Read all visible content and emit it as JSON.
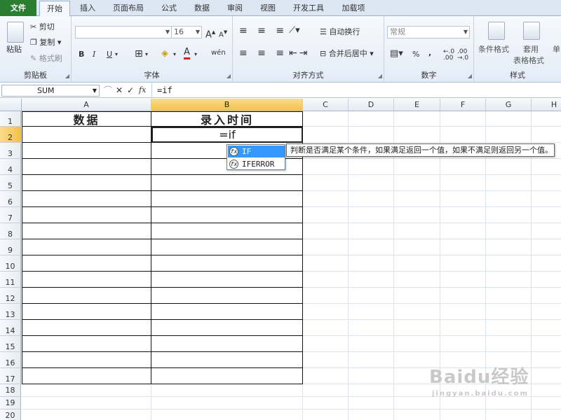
{
  "tabs": [
    {
      "label": "文件",
      "key": "file"
    },
    {
      "label": "开始",
      "key": "home"
    },
    {
      "label": "插入",
      "key": "insert"
    },
    {
      "label": "页面布局",
      "key": "layout"
    },
    {
      "label": "公式",
      "key": "formulas"
    },
    {
      "label": "数据",
      "key": "data"
    },
    {
      "label": "审阅",
      "key": "review"
    },
    {
      "label": "视图",
      "key": "view"
    },
    {
      "label": "开发工具",
      "key": "dev"
    },
    {
      "label": "加载项",
      "key": "addins"
    }
  ],
  "ribbon": {
    "clipboard": {
      "group": "剪贴板",
      "paste": "粘贴",
      "cut": "剪切",
      "copy": "复制",
      "format_painter": "格式刷"
    },
    "font": {
      "group": "字体",
      "font_size": "16",
      "bold": "B",
      "italic": "I",
      "underline": "U",
      "increase": "A",
      "decrease": "A",
      "font_color": "A",
      "phonetic": "wén"
    },
    "alignment": {
      "group": "对齐方式",
      "wrap_text": "自动换行",
      "merge_center": "合并后居中"
    },
    "number": {
      "group": "数字",
      "format": "常规",
      "percent": "%",
      "comma": ","
    },
    "styles": {
      "group": "样式",
      "conditional": "条件格式",
      "table_format_1": "套用",
      "table_format_2": "表格格式",
      "cell_styles": "单"
    }
  },
  "formula_bar": {
    "name_box": "SUM",
    "cancel": "✕",
    "confirm": "✓",
    "fx": "fx",
    "content": "=if"
  },
  "columns": [
    "A",
    "B",
    "C",
    "D",
    "E",
    "F",
    "G",
    "H"
  ],
  "rows": [
    "1",
    "2",
    "3",
    "4",
    "5",
    "6",
    "7",
    "8",
    "9",
    "10",
    "11",
    "12",
    "13",
    "14",
    "15",
    "16",
    "17",
    "18",
    "19",
    "20"
  ],
  "cells": {
    "A1": "数据",
    "B1": "录入时间",
    "B2": "=if"
  },
  "autocomplete": {
    "items": [
      {
        "icon": "fx",
        "label": "IF"
      },
      {
        "icon": "fx",
        "label": "IFERROR"
      }
    ],
    "tooltip": "判断是否满足某个条件，如果满足返回一个值，如果不满足则返回另一个值。"
  },
  "watermark": {
    "brand": "Baidu经验",
    "url": "jingyan.baidu.com"
  }
}
